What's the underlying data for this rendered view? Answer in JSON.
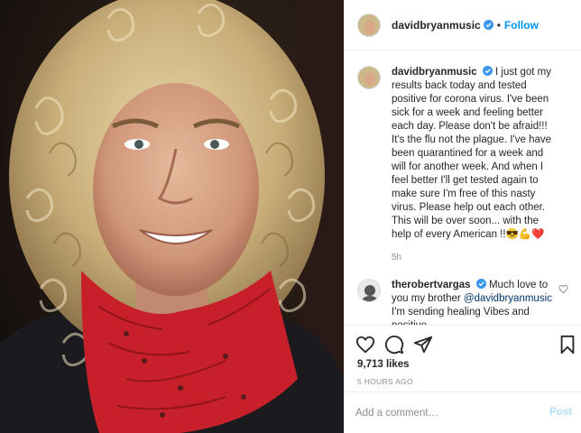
{
  "post": {
    "author": "davidbryanmusic",
    "follow_label": "Follow",
    "separator": "•",
    "caption_text": "I just got my results back today and tested positive for corona virus. I've been sick for a week and feeling better each day. Please don't be afraid!!! It's the flu not the plague. I've have been quarantined for a week and will for another week. And when I feel better I'll get tested again to make sure I'm free of this nasty virus. Please help out each other. This will be over soon... with the help of every American !!😎💪❤️",
    "caption_age": "5h"
  },
  "comments": [
    {
      "username": "therobertvargas",
      "text_before": "Much love to you my brother",
      "mention": "@davidbryanmusic",
      "text_after": "I'm sending healing Vibes and positive"
    }
  ],
  "stats": {
    "likes": "9,713 likes",
    "posted": "5 HOURS AGO"
  },
  "add_comment": {
    "placeholder": "Add a comment…",
    "post_label": "Post"
  },
  "colors": {
    "accent": "#0095f6",
    "verified": "#3897f0",
    "scarf": "#c8202a"
  },
  "icons": [
    "verified-badge-icon",
    "heart-icon",
    "comment-icon",
    "share-icon",
    "bookmark-icon"
  ]
}
